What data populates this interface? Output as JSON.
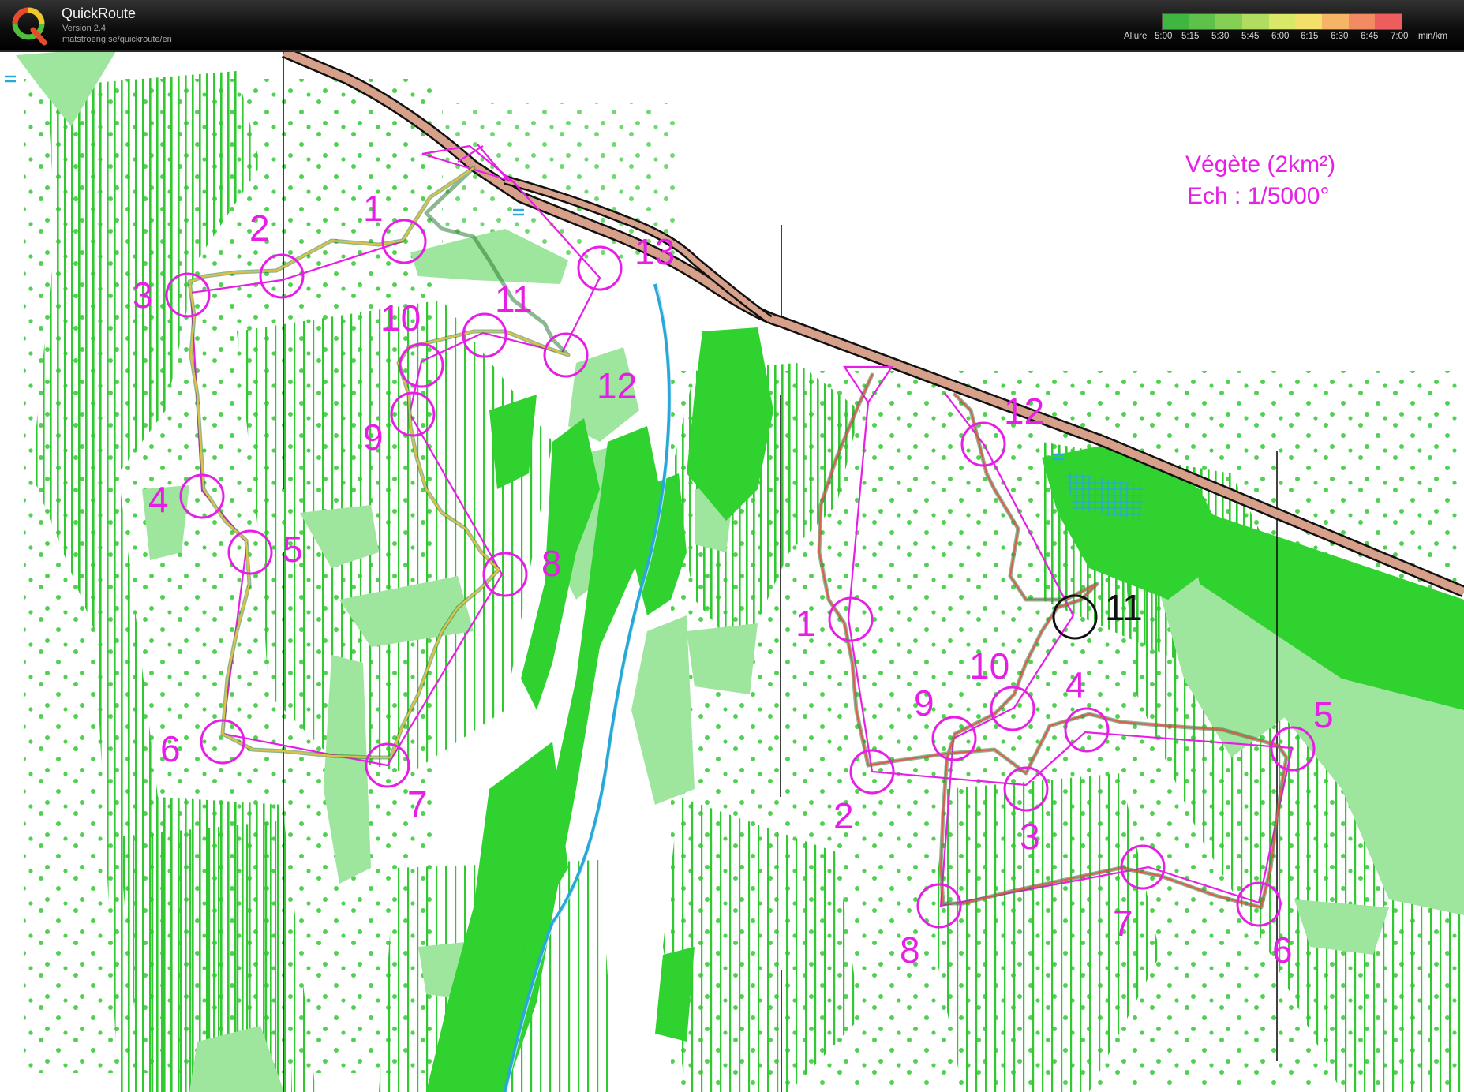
{
  "app": {
    "name": "QuickRoute",
    "version": "Version 2.4",
    "url": "matstroeng.se/quickroute/en"
  },
  "legend": {
    "label": "Allure",
    "ticks": [
      "5:00",
      "5:15",
      "5:30",
      "5:45",
      "6:00",
      "6:15",
      "6:30",
      "6:45",
      "7:00"
    ],
    "unit": "min/km",
    "colors": [
      "#3fb63f",
      "#5ec24a",
      "#86cf55",
      "#b0dc5f",
      "#d9e867",
      "#f3e06a",
      "#f5b466",
      "#f28a63",
      "#ee5d5d"
    ]
  },
  "map": {
    "title": "Végète (2km²)",
    "scale": "Ech : 1/5000°",
    "colors": {
      "course": "#e61ee6",
      "road_fill": "#d6a08a",
      "river": "#27a8d8",
      "green_dark": "#2fd22f",
      "green_light": "#9ee69e",
      "stripes": "#32c832"
    }
  },
  "course_a": {
    "controls": [
      "1",
      "2",
      "3",
      "4",
      "5",
      "6",
      "7",
      "8",
      "9",
      "10",
      "11",
      "12",
      "13"
    ]
  },
  "course_b": {
    "controls": [
      "1",
      "2",
      "3",
      "4",
      "5",
      "6",
      "7",
      "8",
      "9",
      "10",
      "11",
      "12"
    ]
  }
}
